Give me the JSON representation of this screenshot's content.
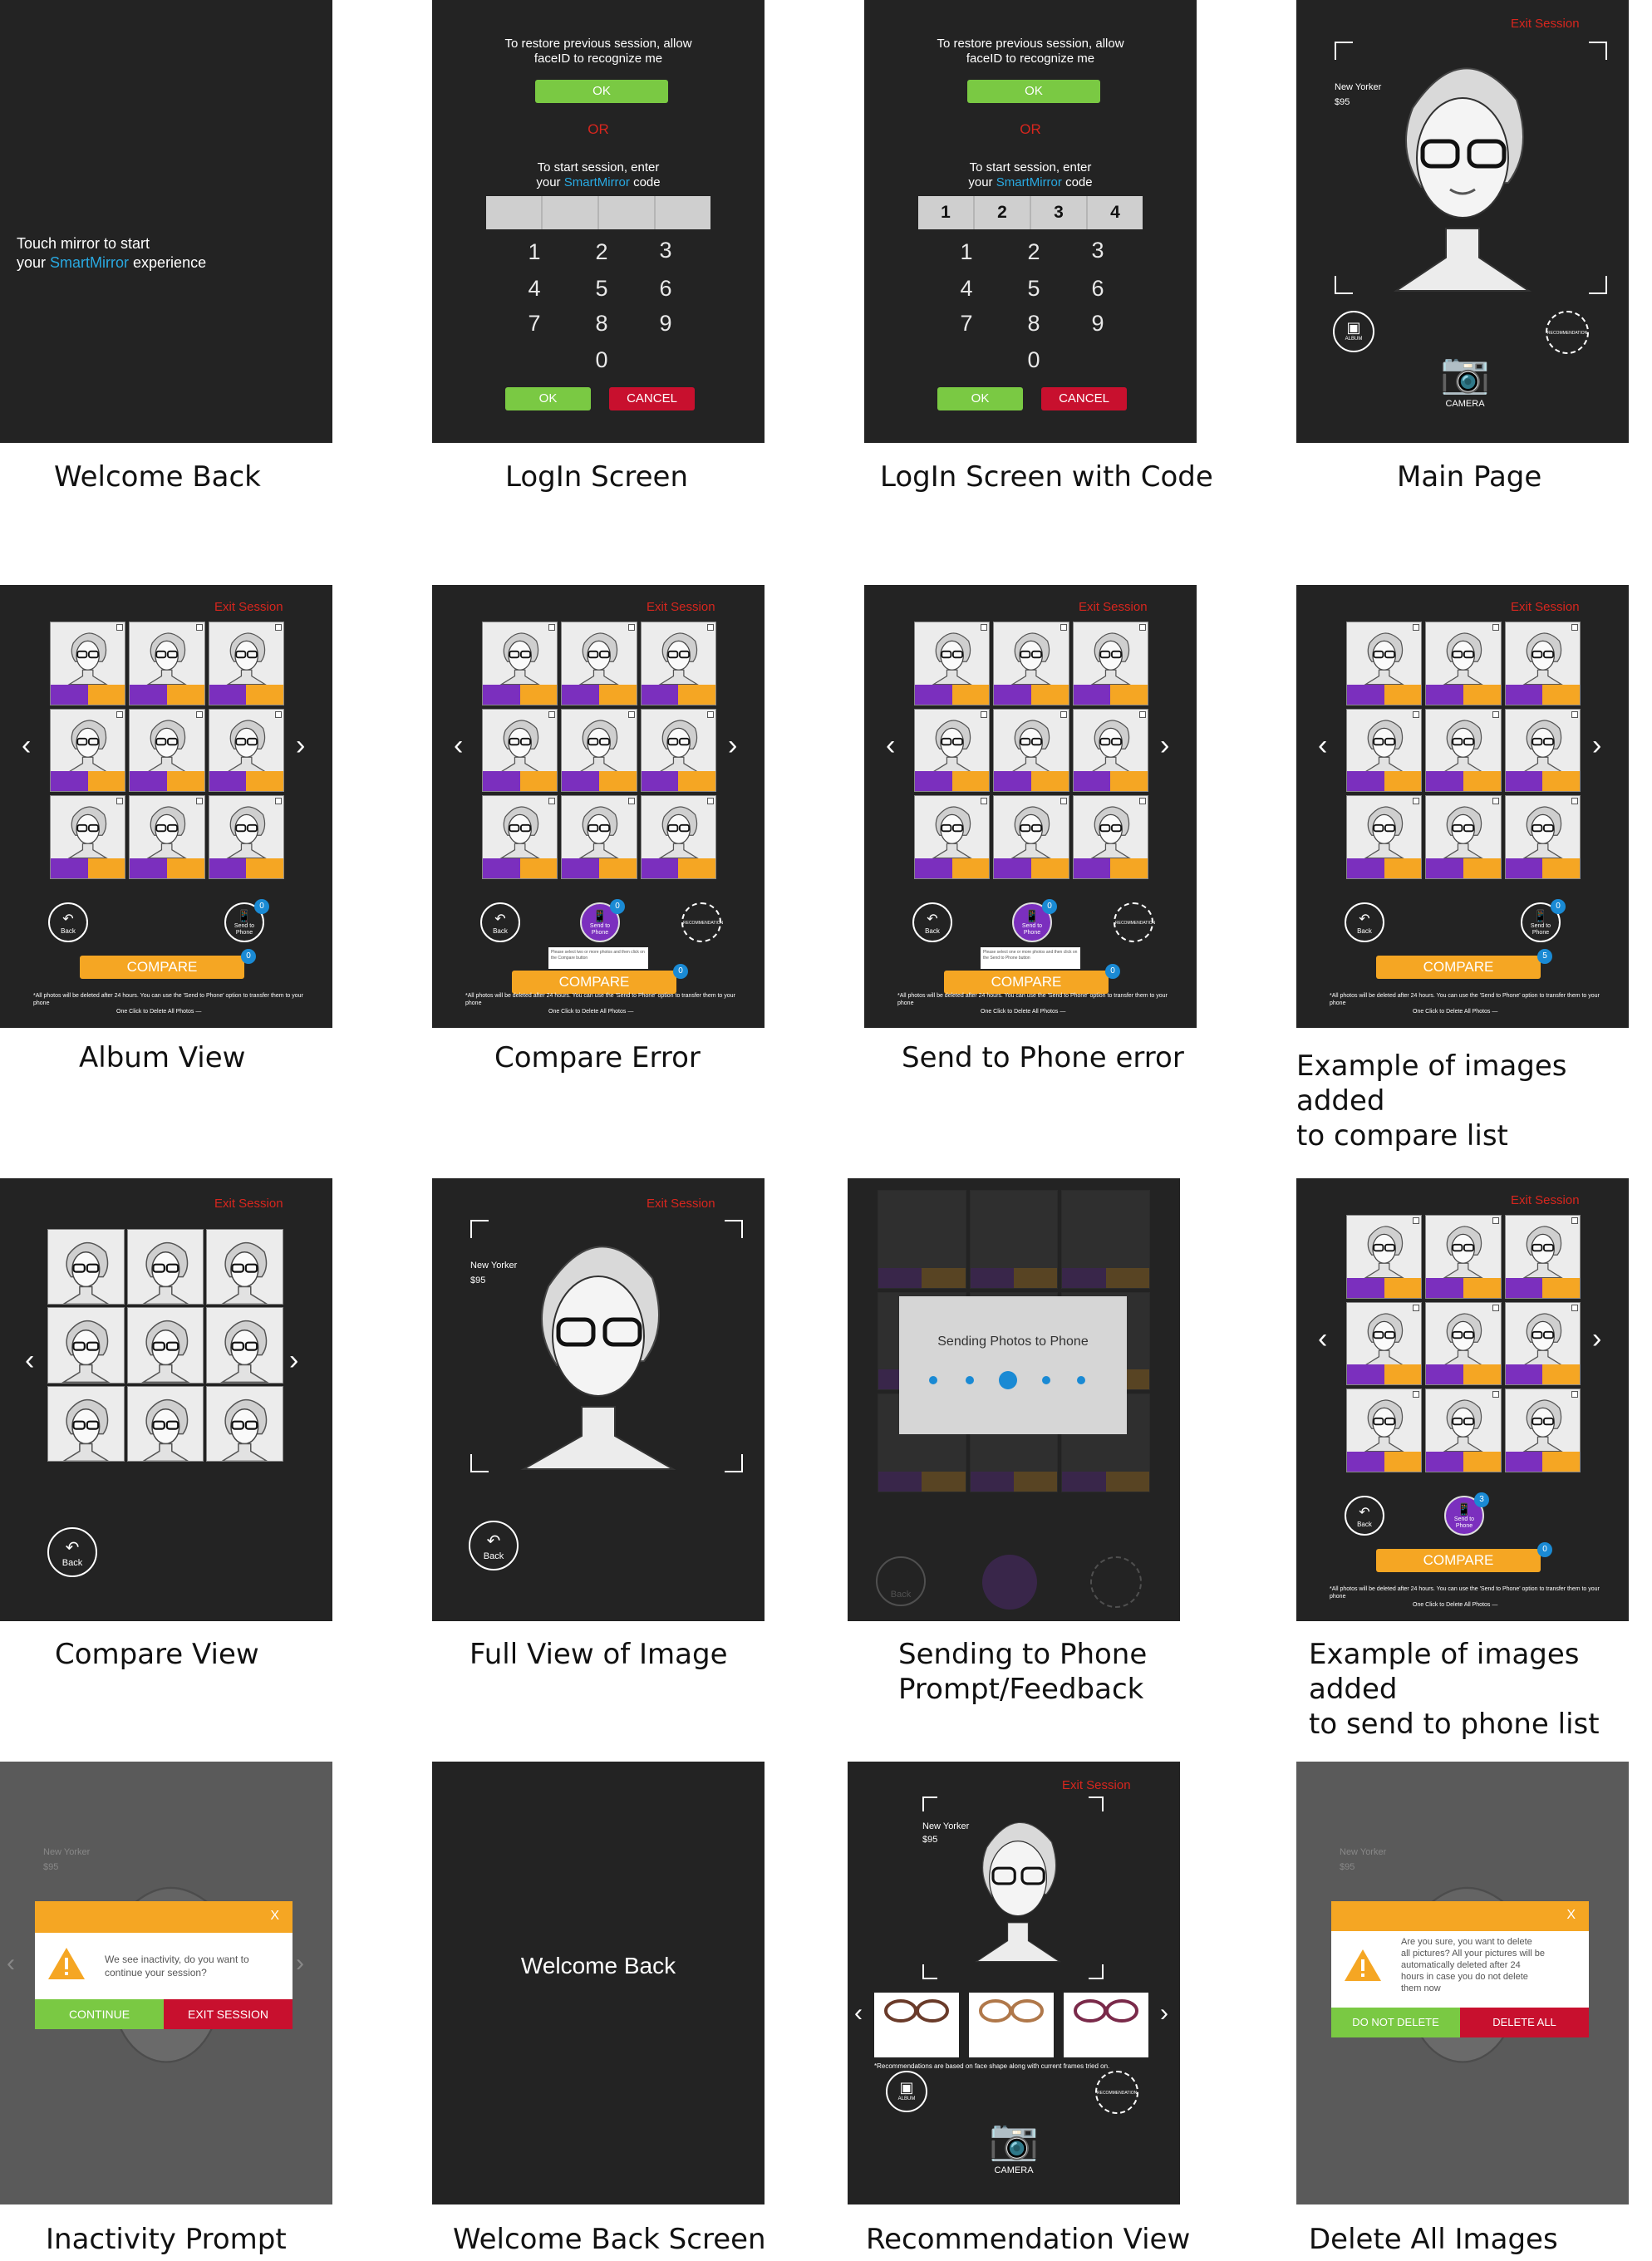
{
  "screens": {
    "welcome_back": {
      "caption": "Welcome Back",
      "line1": "Touch mirror to start",
      "line2_prefix": "your ",
      "line2_brand": "SmartMirror",
      "line2_suffix": " experience"
    },
    "login": {
      "caption": "LogIn Screen",
      "restore_line1": "To restore previous session, allow",
      "restore_line2": "faceID to recognize me",
      "ok_top": "OK",
      "or": "OR",
      "start_line1": "To start session, enter",
      "start_prefix": "your ",
      "start_brand": "SmartMirror",
      "start_suffix": " code",
      "ok": "OK",
      "cancel": "CANCEL",
      "keys": [
        "1",
        "2",
        "3",
        "4",
        "5",
        "6",
        "7",
        "8",
        "9",
        "0"
      ]
    },
    "login_code": {
      "caption": "LogIn Screen with Code",
      "code": [
        "1",
        "2",
        "3",
        "4"
      ]
    },
    "main_page": {
      "caption": "Main Page",
      "exit": "Exit Session",
      "frame_name": "New Yorker",
      "price": "$95",
      "album": "ALBUM",
      "recommendation": "RECOMMENDATION",
      "camera": "CAMERA"
    },
    "album_view": {
      "caption": "Album View"
    },
    "compare_error": {
      "caption": "Compare Error",
      "tooltip": "Please select two or more photos and then click on the Compare button"
    },
    "send_error": {
      "caption": "Send to Phone error",
      "tooltip": "Please select one or more photos and then click on the Send to Phone button"
    },
    "compare_list": {
      "caption": "Example of images added\nto compare list"
    },
    "compare_view": {
      "caption": "Compare View"
    },
    "full_view": {
      "caption": "Full View of Image"
    },
    "sending": {
      "caption": "Sending to Phone\nPrompt/Feedback",
      "message": "Sending Photos to Phone"
    },
    "send_list": {
      "caption": "Example of images added\nto send to phone list"
    },
    "inactivity": {
      "caption": "Inactivity Prompt",
      "close": "X",
      "message_line1": "We see inactivity, do you want to",
      "message_line2": "continue your session?",
      "continue": "CONTINUE",
      "exit": "EXIT SESSION"
    },
    "welcome_screen": {
      "caption": "Welcome Back Screen",
      "text": "Welcome Back"
    },
    "recommendation": {
      "caption": "Recommendation View",
      "note": "*Recommendations are based on face shape along with current frames tried on.",
      "camera": "CAMERA"
    },
    "delete_all": {
      "caption": "Delete All Images Prompt",
      "close": "X",
      "line1": "Are you sure, you want to delete",
      "line2": "all pictures? All your pictures will be",
      "line3": "automatically deleted after 24",
      "line4": "hours in case you do not delete",
      "line5": "them now",
      "no": "DO NOT DELETE",
      "yes": "DELETE ALL"
    }
  },
  "common": {
    "exit_session": "Exit Session",
    "back": "Back",
    "send_to_phone": "Send to Phone",
    "recommendation": "RECOMMENDATION",
    "compare": "COMPARE",
    "disclaimer": "*All photos will be deleted after 24 hours. You can use the 'Send to Phone' option to transfer them to your phone",
    "delete_all_link": "One Click to Delete All Photos —",
    "badge_zero": "0",
    "badge_five": "5",
    "badge_three": "3"
  },
  "colors": {
    "background": "#232323",
    "accent_orange": "#f5a623",
    "accent_purple": "#7b2fbe",
    "ok_green": "#7ac943",
    "cancel_red": "#c8102e",
    "brand_blue": "#29a9e1",
    "exit_red": "#d7261e"
  }
}
